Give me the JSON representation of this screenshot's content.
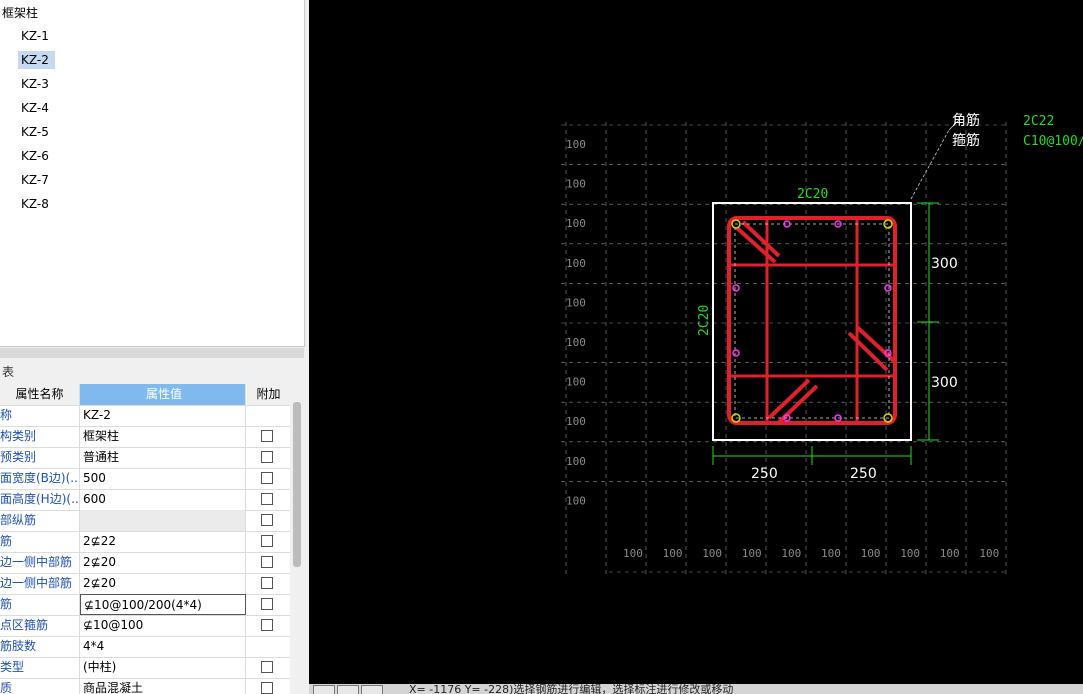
{
  "tree": {
    "root_label": "框架柱",
    "items": [
      {
        "label": "KZ-1",
        "selected": false
      },
      {
        "label": "KZ-2",
        "selected": true
      },
      {
        "label": "KZ-3",
        "selected": false
      },
      {
        "label": "KZ-4",
        "selected": false
      },
      {
        "label": "KZ-5",
        "selected": false
      },
      {
        "label": "KZ-6",
        "selected": false
      },
      {
        "label": "KZ-7",
        "selected": false
      },
      {
        "label": "KZ-8",
        "selected": false
      }
    ]
  },
  "props": {
    "panel_title": "表",
    "col_name": "属性名称",
    "col_value": "属性值",
    "col_extra": "附加",
    "rows": [
      {
        "name": "称",
        "value": "KZ-2",
        "checkbox": false
      },
      {
        "name": "构类别",
        "value": "框架柱",
        "checkbox": true
      },
      {
        "name": "预类别",
        "value": "普通柱",
        "checkbox": true
      },
      {
        "name": "面宽度(B边)(...",
        "value": "500",
        "checkbox": true
      },
      {
        "name": "面高度(H边)(...",
        "value": "600",
        "checkbox": true
      },
      {
        "name": "部纵筋",
        "value": "",
        "checkbox": true
      },
      {
        "name": "筋",
        "value": "2⊈22",
        "checkbox": true
      },
      {
        "name": "边一侧中部筋",
        "value": "2⊈20",
        "checkbox": true
      },
      {
        "name": "边一侧中部筋",
        "value": "2⊈20",
        "checkbox": true
      },
      {
        "name": "筋",
        "value": "⊈10@100/200(4*4)",
        "checkbox": true
      },
      {
        "name": "点区箍筋",
        "value": "⊈10@100",
        "checkbox": true
      },
      {
        "name": "筋肢数",
        "value": "4*4",
        "checkbox": false
      },
      {
        "name": "类型",
        "value": "(中柱)",
        "checkbox": true
      },
      {
        "name": "质",
        "value": "商品混凝土",
        "checkbox": true
      }
    ]
  },
  "cad": {
    "grid_label": "100",
    "callout_corner": "角筋",
    "callout_stirrup": "箍筋",
    "callout_corner_value": "2C22",
    "callout_stirrup_value": "C10@100/",
    "top_bar_label": "2C20",
    "side_bar_label": "2C20",
    "dim_right_upper": "300",
    "dim_right_lower": "300",
    "dim_bottom_left": "250",
    "dim_bottom_right": "250",
    "colors": {
      "grid": "#8a8a8a",
      "rebar": "#e0202a",
      "dim": "#22dd22",
      "outline": "#ffffff",
      "bar_dot": "#ff33ff",
      "text": "#ffffff"
    }
  },
  "status": {
    "text": "X= -1176 Y= -228)选择钢筋进行编辑，选择标注进行修改或移动"
  }
}
